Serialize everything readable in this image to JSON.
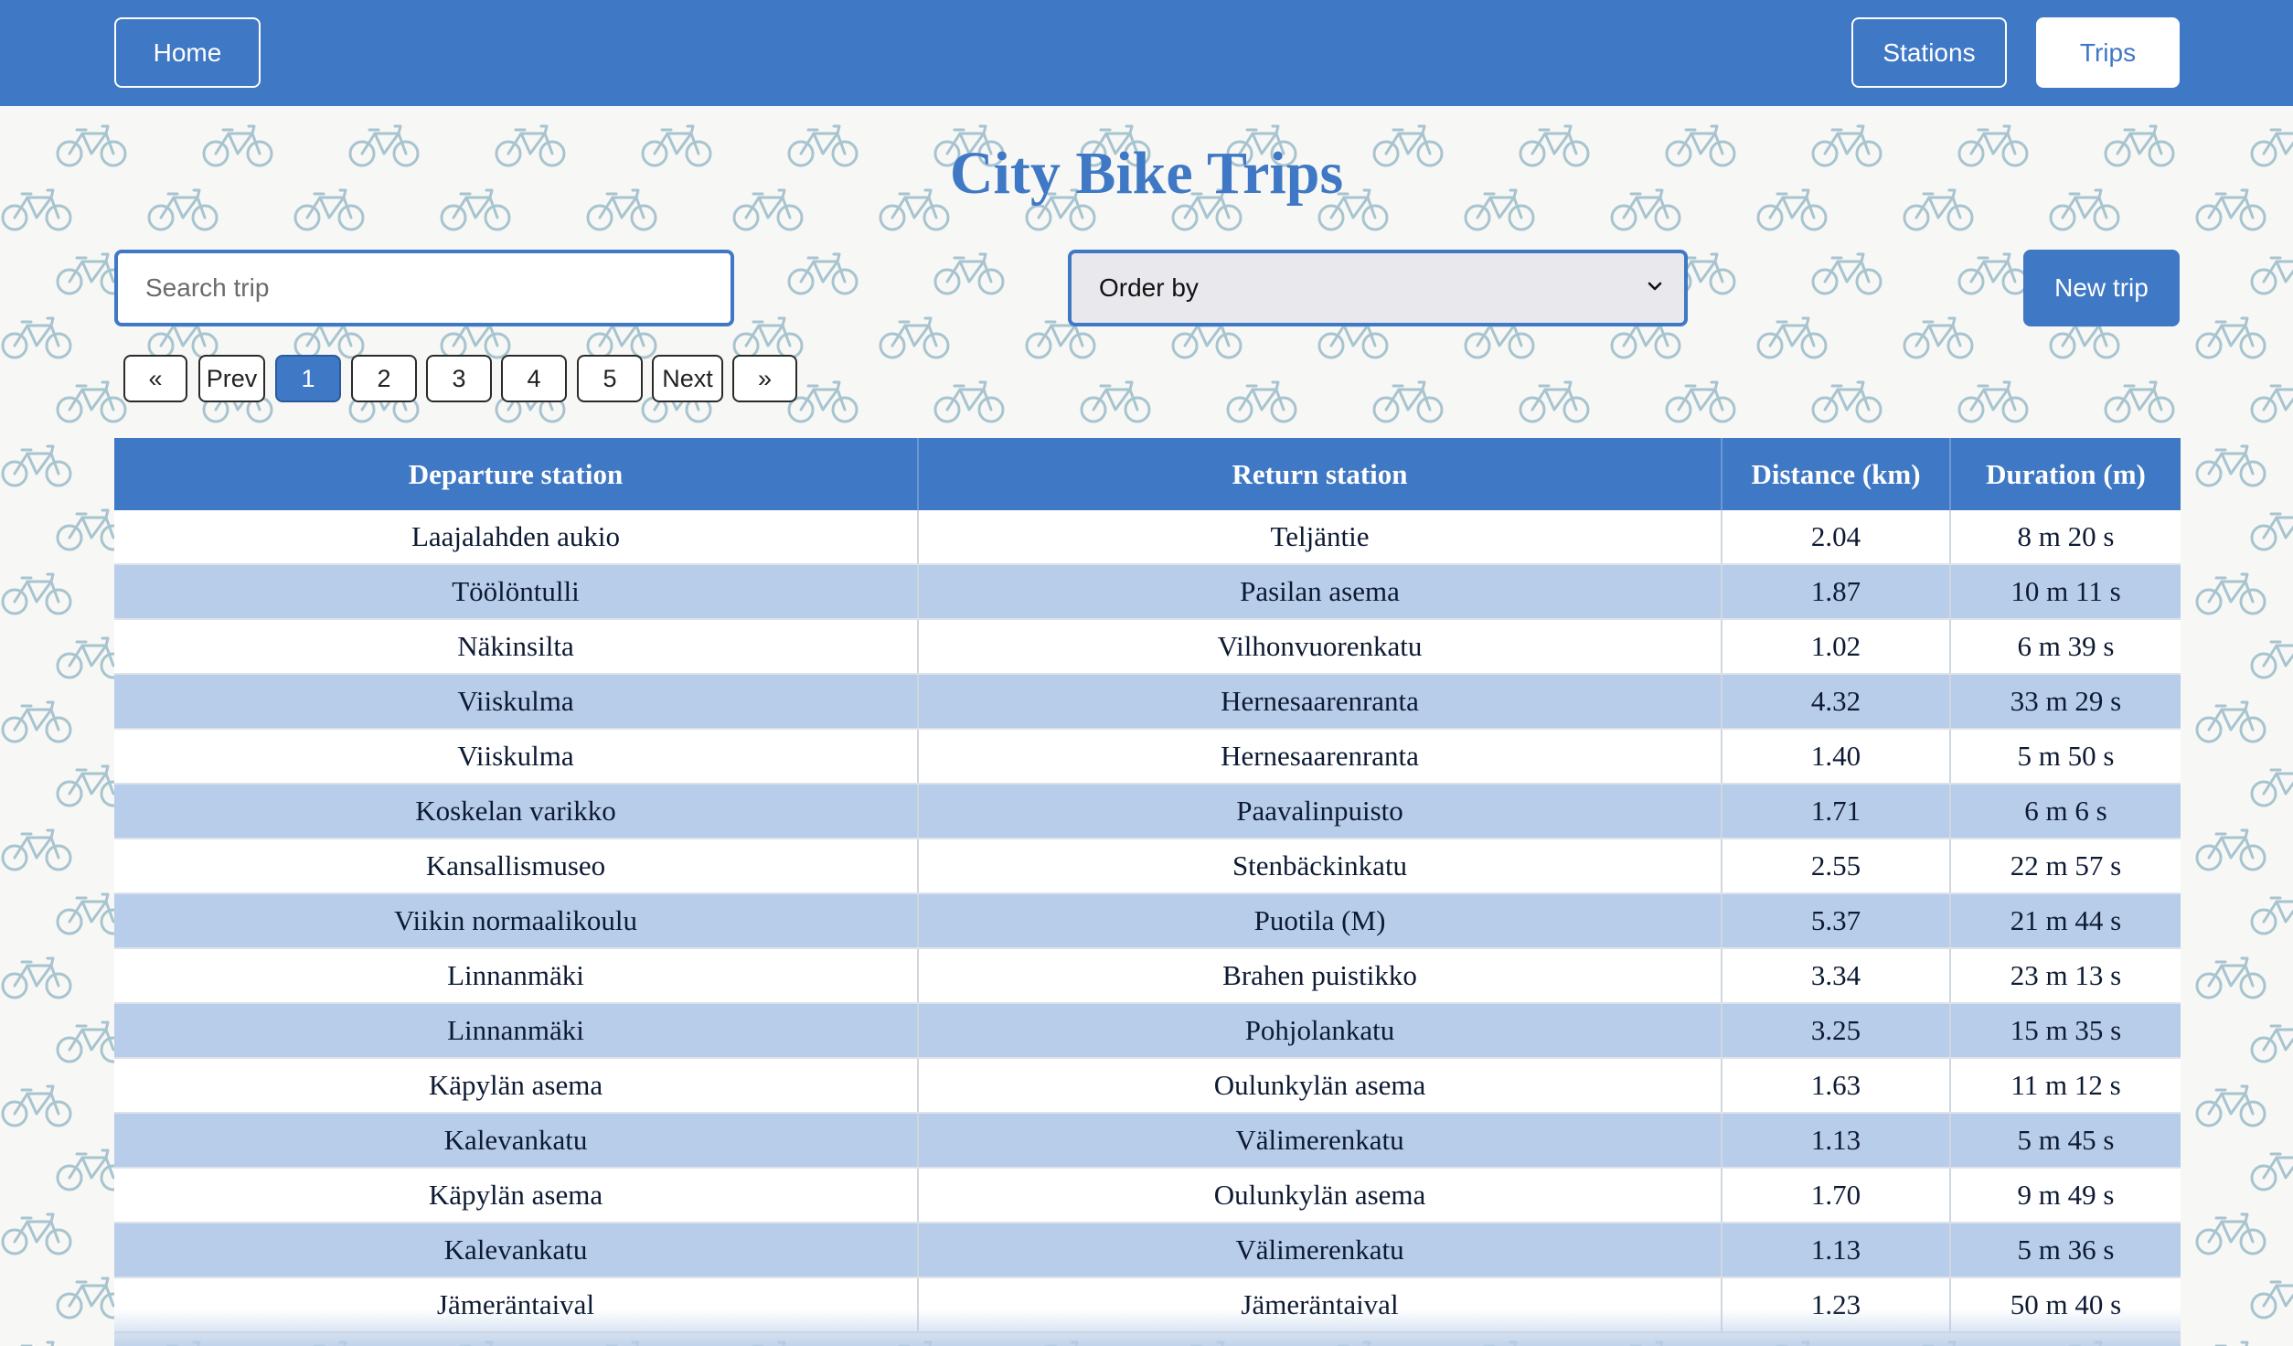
{
  "nav": {
    "home": "Home",
    "stations": "Stations",
    "trips": "Trips"
  },
  "page": {
    "title": "City Bike Trips"
  },
  "search": {
    "placeholder": "Search trip",
    "value": ""
  },
  "order": {
    "selected": "Order by",
    "icon": "chevron-down-icon"
  },
  "new_trip": "New trip",
  "background_icon": "bicycle-icon",
  "pagination": {
    "first": "«",
    "prev": "Prev",
    "next": "Next",
    "last": "»",
    "pages": [
      "1",
      "2",
      "3",
      "4",
      "5"
    ],
    "current": "1"
  },
  "table": {
    "headers": [
      "Departure station",
      "Return station",
      "Distance (km)",
      "Duration (m)"
    ],
    "rows": [
      [
        "Laajalahden aukio",
        "Teljäntie",
        "2.04",
        "8 m 20 s"
      ],
      [
        "Töölöntulli",
        "Pasilan asema",
        "1.87",
        "10 m 11 s"
      ],
      [
        "Näkinsilta",
        "Vilhonvuorenkatu",
        "1.02",
        "6 m 39 s"
      ],
      [
        "Viiskulma",
        "Hernesaarenranta",
        "4.32",
        "33 m 29 s"
      ],
      [
        "Viiskulma",
        "Hernesaarenranta",
        "1.40",
        "5 m 50 s"
      ],
      [
        "Koskelan varikko",
        "Paavalinpuisto",
        "1.71",
        "6 m 6 s"
      ],
      [
        "Kansallismuseo",
        "Stenbäckinkatu",
        "2.55",
        "22 m 57 s"
      ],
      [
        "Viikin normaalikoulu",
        "Puotila (M)",
        "5.37",
        "21 m 44 s"
      ],
      [
        "Linnanmäki",
        "Brahen puistikko",
        "3.34",
        "23 m 13 s"
      ],
      [
        "Linnanmäki",
        "Pohjolankatu",
        "3.25",
        "15 m 35 s"
      ],
      [
        "Käpylän asema",
        "Oulunkylän asema",
        "1.63",
        "11 m 12 s"
      ],
      [
        "Kalevankatu",
        "Välimerenkatu",
        "1.13",
        "5 m 45 s"
      ],
      [
        "Käpylän asema",
        "Oulunkylän asema",
        "1.70",
        "9 m 49 s"
      ],
      [
        "Kalevankatu",
        "Välimerenkatu",
        "1.13",
        "5 m 36 s"
      ],
      [
        "Jämeräntaival",
        "Jämeräntaival",
        "1.23",
        "50 m 40 s"
      ]
    ]
  },
  "colors": {
    "primary": "#3f78c4",
    "row_alt": "#b8cde9",
    "row_plain": "#ffffff",
    "background": "#f7f7f5",
    "bike_pattern": "#a7c4cf"
  }
}
